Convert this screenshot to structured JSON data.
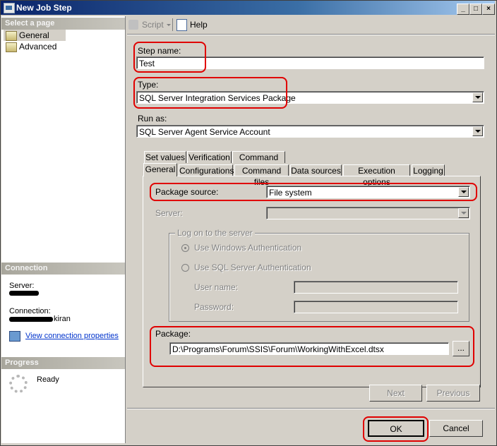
{
  "window": {
    "title": "New Job Step"
  },
  "sidebar": {
    "select_page_heading": "Select a page",
    "pages": [
      {
        "label": "General",
        "selected": true
      },
      {
        "label": "Advanced",
        "selected": false
      }
    ],
    "connection_heading": "Connection",
    "server_label": "Server:",
    "connection_label": "Connection:",
    "connection_value_suffix": "kiran",
    "view_connection_properties": "View connection properties",
    "progress_heading": "Progress",
    "progress_status": "Ready"
  },
  "toolbar": {
    "script_label": "Script",
    "help_label": "Help"
  },
  "form": {
    "step_name_label": "Step name:",
    "step_name_value": "Test",
    "type_label": "Type:",
    "type_value": "SQL Server Integration Services Package",
    "run_as_label": "Run as:",
    "run_as_value": "SQL Server Agent Service Account"
  },
  "tabs": {
    "row1": [
      "Set values",
      "Verification",
      "Command line"
    ],
    "row2": [
      "General",
      "Configurations",
      "Command files",
      "Data sources",
      "Execution options",
      "Logging"
    ]
  },
  "general_tab": {
    "package_source_label": "Package source:",
    "package_source_value": "File system",
    "server_label": "Server:",
    "logon_group": "Log on to the server",
    "windows_auth": "Use Windows Authentication",
    "sql_auth": "Use SQL Server Authentication",
    "user_name_label": "User name:",
    "password_label": "Password:",
    "package_label": "Package:",
    "package_value": "D:\\Programs\\Forum\\SSIS\\Forum\\WorkingWithExcel.dtsx",
    "browse_label": "..."
  },
  "nav_buttons": {
    "next": "Next",
    "previous": "Previous"
  },
  "footer": {
    "ok": "OK",
    "cancel": "Cancel"
  },
  "colors": {
    "highlight": "#e00000",
    "title_bar": "#0a246a",
    "face": "#d4d0c8",
    "link": "#0033cc"
  }
}
